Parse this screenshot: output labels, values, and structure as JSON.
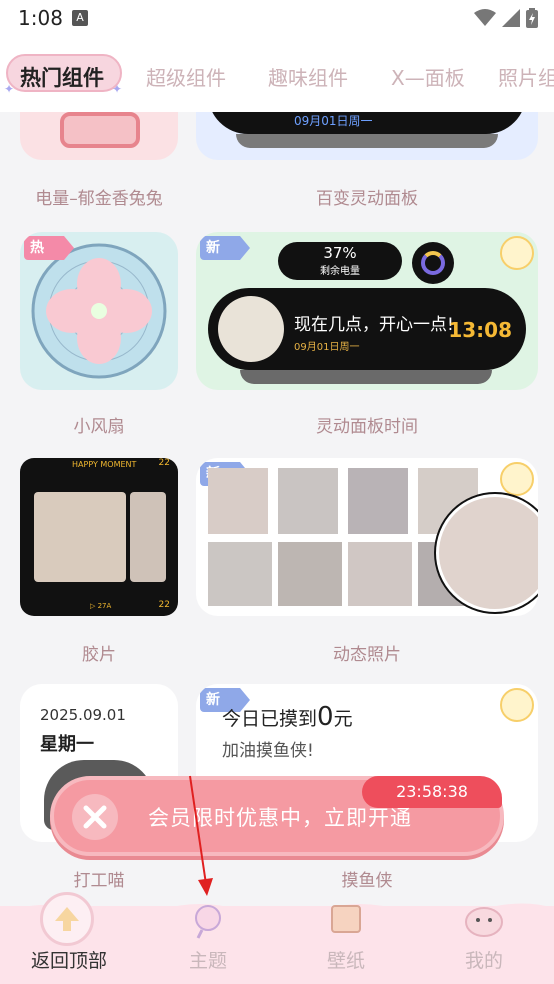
{
  "status_bar": {
    "time": "1:08",
    "notification_icon": "a-letter-icon"
  },
  "tabs": [
    {
      "label": "热门组件",
      "active": true
    },
    {
      "label": "超级组件",
      "active": false
    },
    {
      "label": "趣味组件",
      "active": false
    },
    {
      "label": "X—面板",
      "active": false
    },
    {
      "label": "照片组",
      "active": false
    }
  ],
  "widgets": {
    "battery_tulip": {
      "label": "电量–郁金香兔兔"
    },
    "dynamic_panel": {
      "label": "百变灵动面板",
      "date": "09月01日周一"
    },
    "small_fan": {
      "label": "小风扇",
      "badge": "热"
    },
    "panel_time": {
      "label": "灵动面板时间",
      "badge": "新",
      "battery_percent": "37%",
      "battery_label": "剩余电量",
      "message": "现在几点，开心一点!",
      "time": "13:08",
      "date": "09月01日周一"
    },
    "film": {
      "label": "胶片",
      "film_title": "HAPPY MOMENT",
      "frame_top": "22",
      "frame_bottom": "22",
      "frame_code": "▷ 27A"
    },
    "dynamic_photo": {
      "label": "动态照片",
      "badge": "新"
    },
    "work_cat": {
      "label": "打工喵",
      "date": "2025.09.01",
      "weekday": "星期一"
    },
    "slacker": {
      "label": "摸鱼侠",
      "badge": "新",
      "title_prefix": "今日已摸到",
      "amount": "0",
      "unit": "元",
      "subtitle": "加油摸鱼侠!"
    }
  },
  "promo": {
    "text": "会员限时优惠中，立即开通",
    "countdown": "23:58:38"
  },
  "bottom_nav": [
    {
      "label": "返回顶部",
      "active": true
    },
    {
      "label": "主题",
      "active": false
    },
    {
      "label": "壁纸",
      "active": false
    },
    {
      "label": "我的",
      "active": false
    }
  ],
  "colors": {
    "accent": "#f48aa8",
    "promo": "#f59aa2",
    "badge_new": "#8fa8e8",
    "nav_bg": "#fde3ea"
  }
}
